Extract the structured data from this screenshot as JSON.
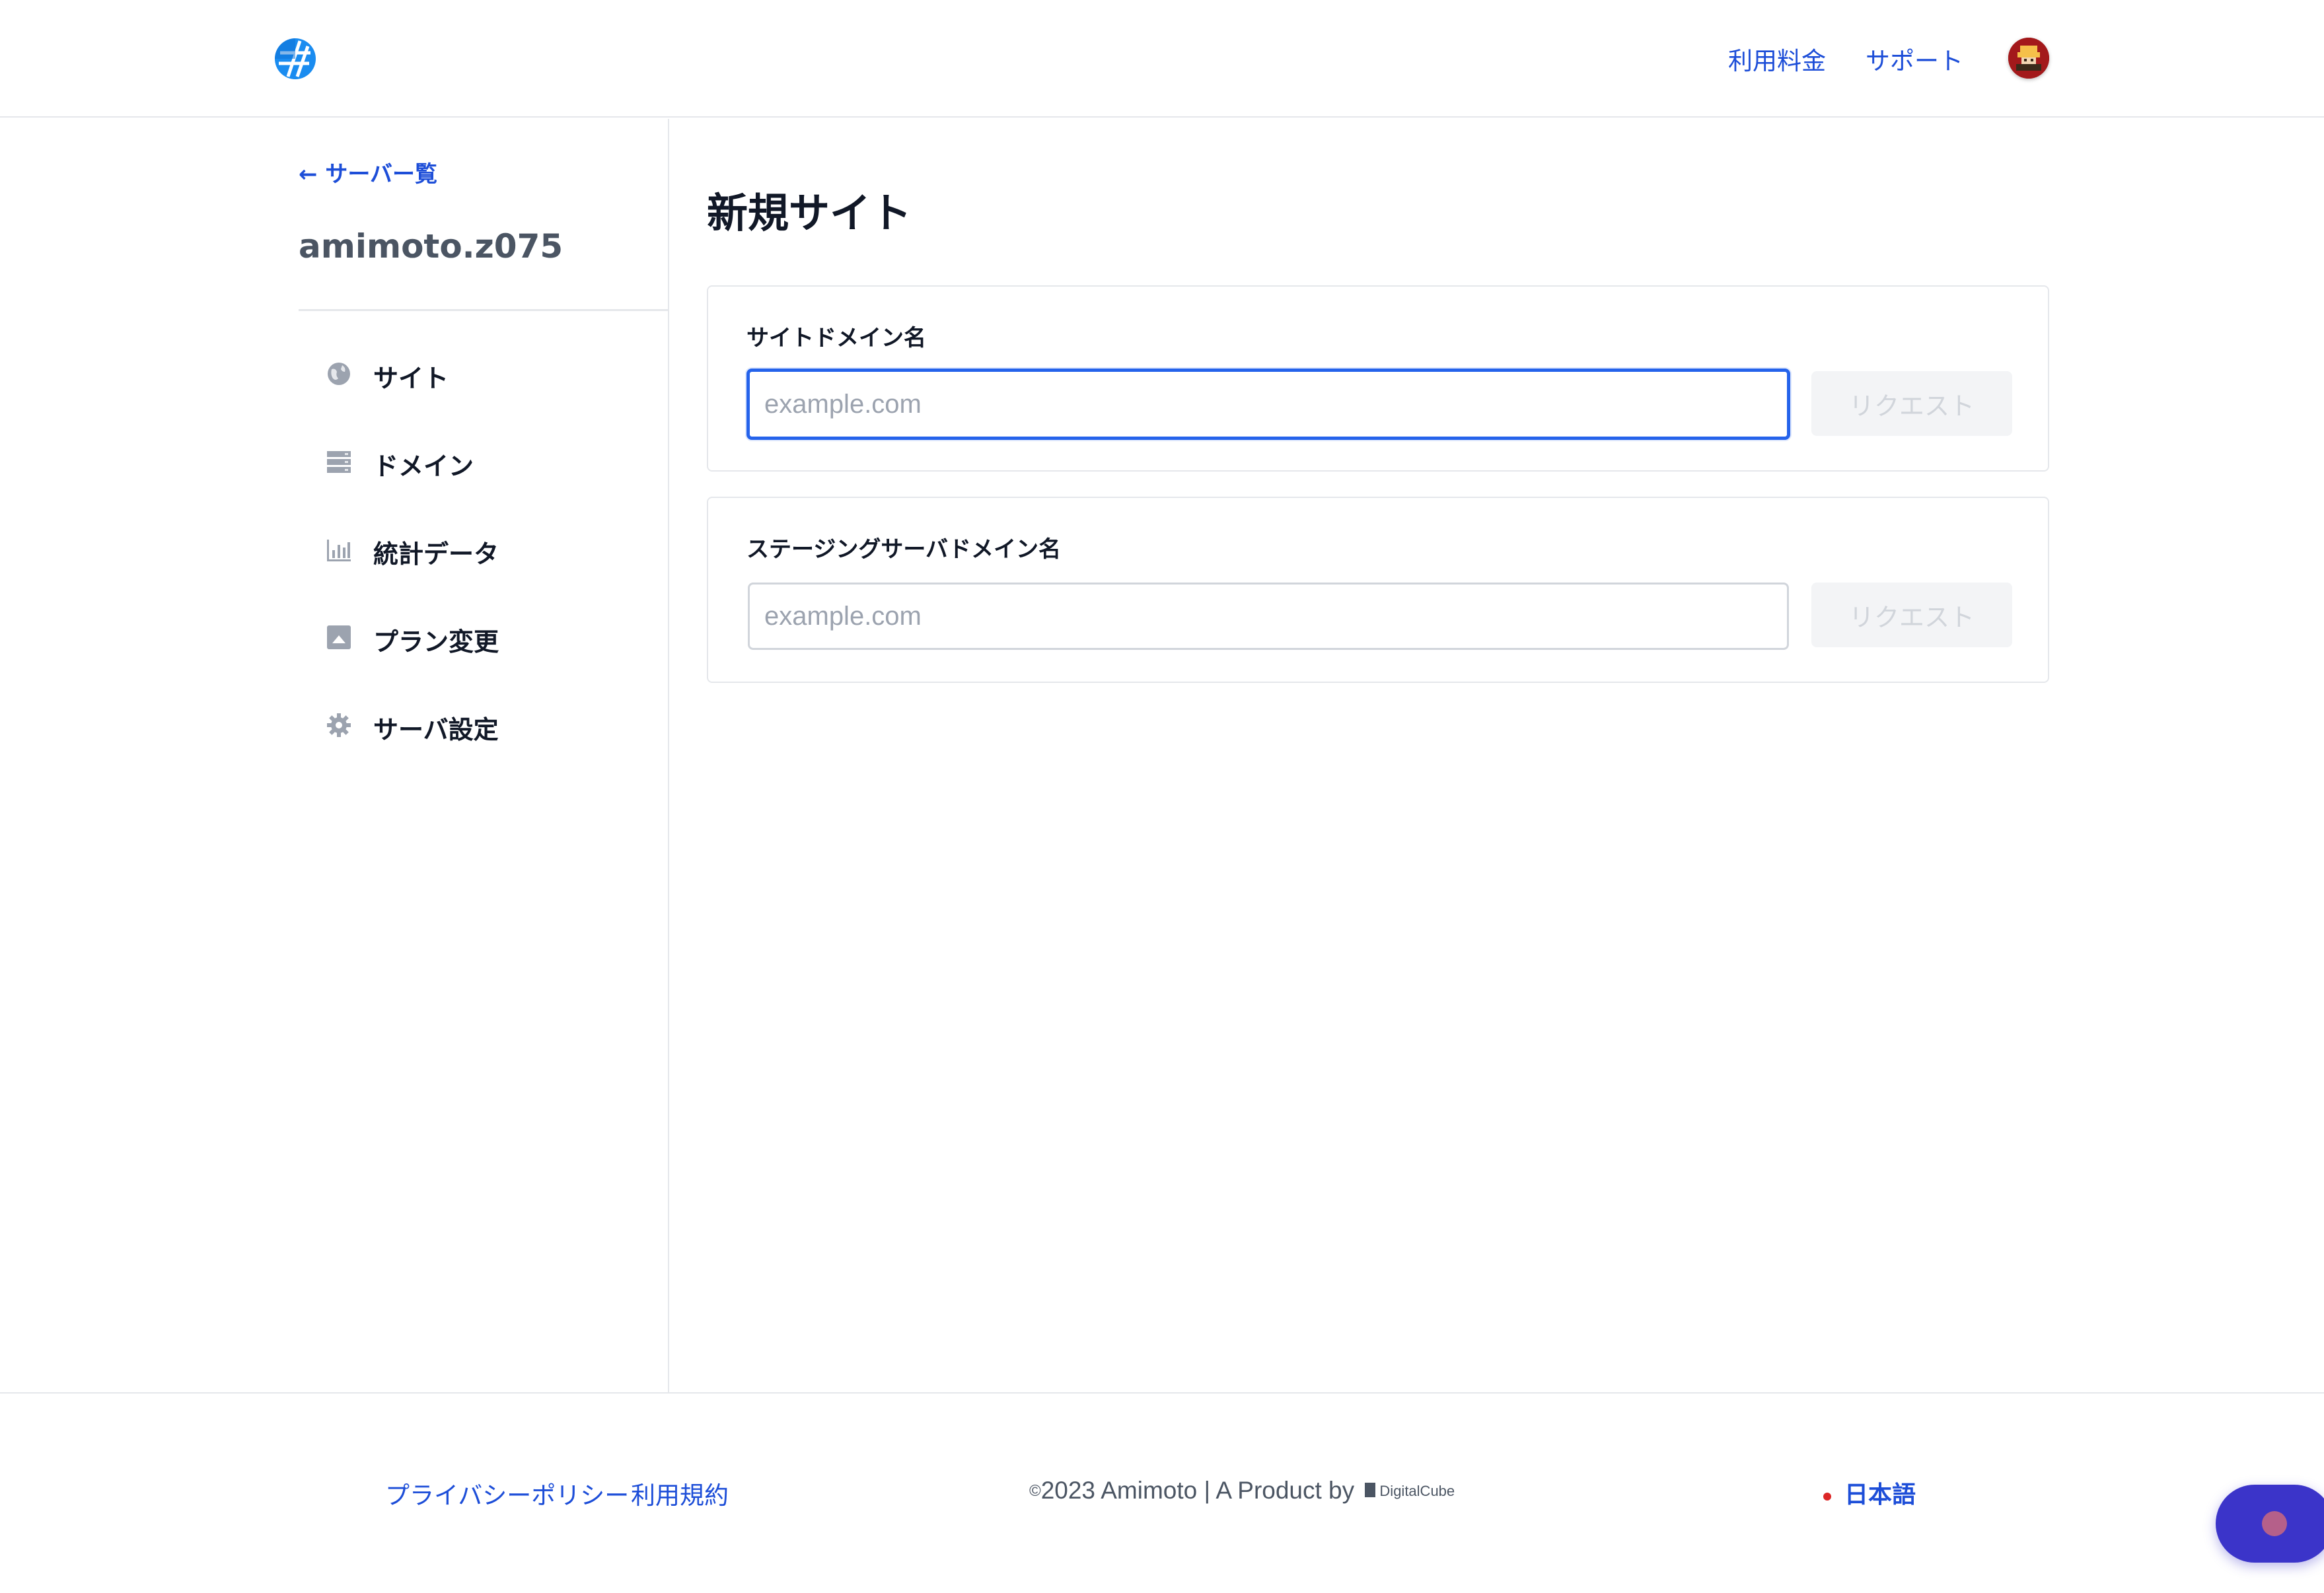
{
  "header": {
    "nav": {
      "pricing": "利用料金",
      "support": "サポート"
    }
  },
  "sidebar": {
    "back_link": "← サーバー覧",
    "server_name": "amimoto.z075",
    "items": [
      {
        "label": "サイト",
        "icon": "globe-icon"
      },
      {
        "label": "ドメイン",
        "icon": "server-list-icon"
      },
      {
        "label": "統計データ",
        "icon": "bar-chart-icon"
      },
      {
        "label": "プラン変更",
        "icon": "upgrade-icon"
      },
      {
        "label": "サーバ設定",
        "icon": "gear-icon"
      }
    ]
  },
  "main": {
    "title": "新規サイト",
    "site_domain": {
      "label": "サイトドメイン名",
      "placeholder": "example.com",
      "button": "リクエスト"
    },
    "staging_domain": {
      "label": "ステージングサーバドメイン名",
      "placeholder": "example.com",
      "button": "リクエスト"
    }
  },
  "footer": {
    "privacy": "プライバシーポリシー",
    "terms": "利用規約",
    "copyright_mark": "©",
    "copyright": "2023 Amimoto | A Product by",
    "brand": "DigitalCube",
    "language": "日本語"
  },
  "colors": {
    "accent": "#1d4ed8",
    "focus_border": "#2563eb",
    "chat_button": "#3b34c9"
  }
}
